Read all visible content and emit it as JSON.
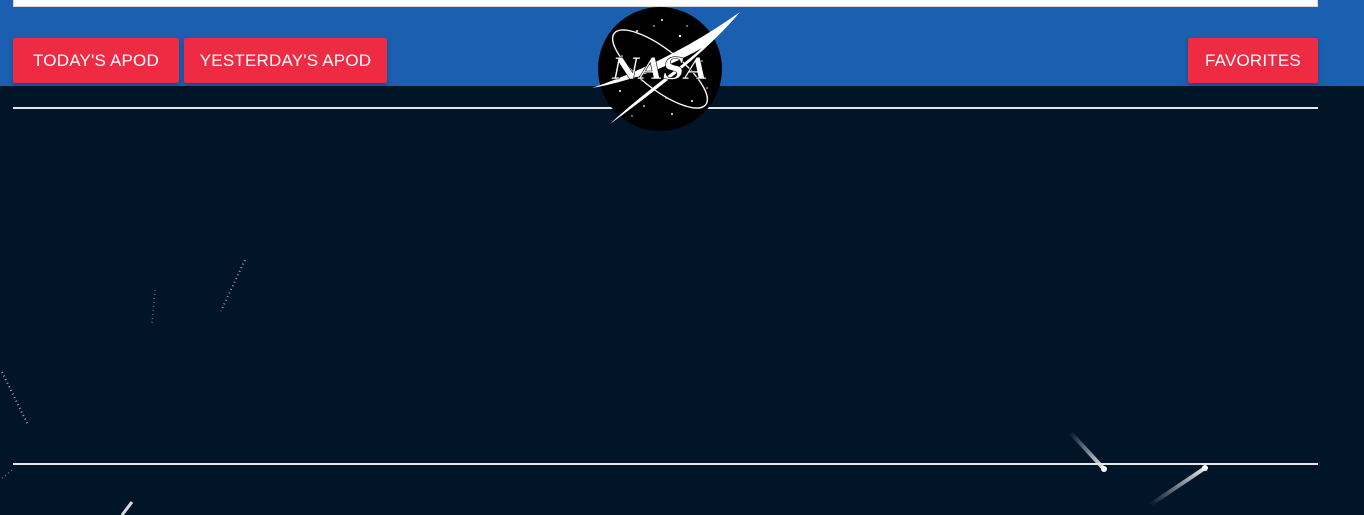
{
  "nav": {
    "today_label": "TODAY'S APOD",
    "yesterday_label": "YESTERDAY'S APOD",
    "favorites_label": "FAVORITES"
  },
  "logo": {
    "text": "NASA",
    "icon": "nasa-logo-icon"
  },
  "colors": {
    "header": "#1b5fb0",
    "background": "#011529",
    "button": "#ef2b43",
    "button_text": "#ffffff",
    "divider": "#e6e6e6"
  }
}
